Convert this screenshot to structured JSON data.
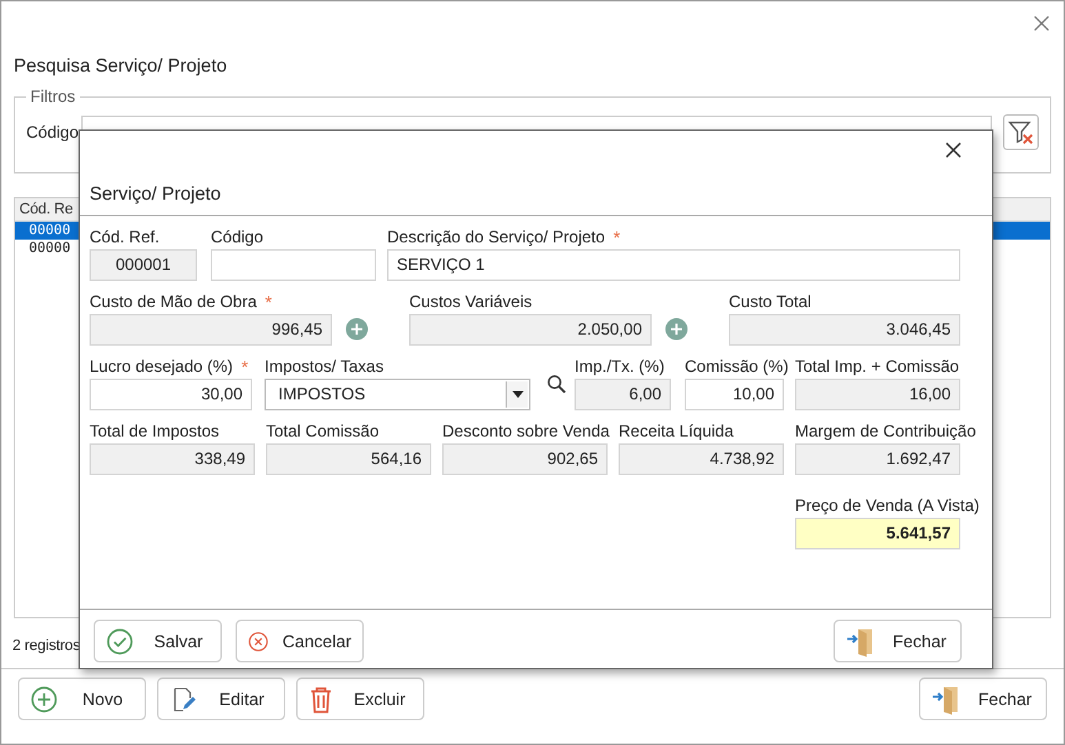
{
  "window": {
    "title": "Pesquisa Serviço/ Projeto"
  },
  "filters": {
    "legend": "Filtros",
    "label": "Código"
  },
  "table": {
    "columns": [
      "Cód. Re"
    ],
    "rows": [
      {
        "cells": [
          "00000"
        ],
        "selected": true
      },
      {
        "cells": [
          "00000"
        ],
        "selected": false
      }
    ]
  },
  "record_count": "2 registros",
  "toolbar": [
    {
      "label": "Novo"
    },
    {
      "label": "Editar"
    },
    {
      "label": "Excluir"
    },
    {
      "label": "Fechar"
    }
  ],
  "dialog": {
    "title": "Serviço/ Projeto",
    "lines": [
      {
        "fields": [
          {
            "kind": "field",
            "label": "Cód. Ref.",
            "value": "000001",
            "readonly": true
          },
          {
            "kind": "field",
            "label": "Código",
            "readonly": false
          },
          {
            "kind": "field",
            "label": "Descrição do Serviço/ Projeto",
            "value": "SERVIÇO 1",
            "readonly": false,
            "required_mark": "*"
          }
        ]
      },
      {
        "fields": [
          {
            "kind": "field",
            "label": "Custo de Mão de Obra",
            "value": "996,45",
            "readonly": true,
            "required_mark": "*"
          },
          {
            "kind": "add-button"
          },
          {
            "kind": "field",
            "label": "Custos Variáveis",
            "value": "2.050,00",
            "readonly": true
          },
          {
            "kind": "add-button"
          },
          {
            "kind": "field",
            "label": "Custo Total",
            "value": "3.046,45",
            "readonly": true
          }
        ]
      },
      {
        "fields": [
          {
            "kind": "field",
            "label": "Lucro desejado (%)",
            "value": "30,00",
            "readonly": false,
            "required_mark": "*"
          },
          {
            "kind": "dropdown",
            "label": "Impostos/ Taxas",
            "value": "IMPOSTOS"
          },
          {
            "kind": "search-button"
          },
          {
            "kind": "field",
            "label": "Imp./Tx. (%)",
            "value": "6,00",
            "readonly": true
          },
          {
            "kind": "field",
            "label": "Comissão (%)",
            "value": "10,00",
            "readonly": false
          },
          {
            "kind": "field",
            "label": "Total Imp. + Comissão",
            "value": "16,00",
            "readonly": true
          }
        ]
      },
      {
        "fields": [
          {
            "kind": "field",
            "label": "Total de Impostos",
            "value": "338,49",
            "readonly": true
          },
          {
            "kind": "field",
            "label": "Total Comissão",
            "value": "564,16",
            "readonly": true
          },
          {
            "kind": "field",
            "label": "Desconto sobre Venda",
            "value": "902,65",
            "readonly": true
          },
          {
            "kind": "field",
            "label": "Receita Líquida",
            "value": "4.738,92",
            "readonly": true
          },
          {
            "kind": "field",
            "label": "Margem de Contribuição",
            "value": "1.692,47",
            "readonly": true
          }
        ]
      },
      {
        "fields": [
          {
            "kind": "field",
            "label": "Preço de Venda (A Vista)",
            "value": "5.641,57",
            "highlight": true
          }
        ]
      }
    ],
    "buttons": [
      {
        "label": "Salvar"
      },
      {
        "label": "Cancelar"
      },
      {
        "label": "Fechar"
      }
    ]
  }
}
